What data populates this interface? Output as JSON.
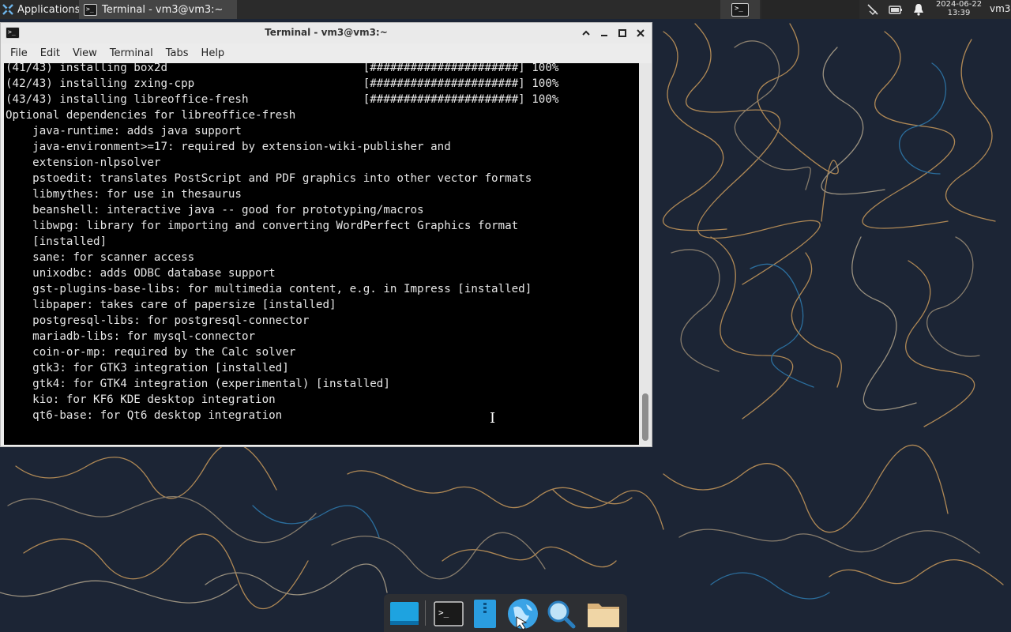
{
  "top_panel": {
    "applications_label": "Applications",
    "task_label": "Terminal - vm3@vm3:~",
    "clock_date": "2024-06-22",
    "clock_time": "13:39",
    "user": "vm3",
    "icons": [
      "applications-menu-icon",
      "terminal-icon",
      "workspace-icon",
      "network-disconnected-icon",
      "battery-icon",
      "notification-bell-icon"
    ]
  },
  "window": {
    "title": "Terminal - vm3@vm3:~",
    "menu": [
      "File",
      "Edit",
      "View",
      "Terminal",
      "Tabs",
      "Help"
    ],
    "terminal_lines": [
      "(41/43) installing box2d                             [######################] 100%",
      "(42/43) installing zxing-cpp                         [######################] 100%",
      "(43/43) installing libreoffice-fresh                 [######################] 100%",
      "Optional dependencies for libreoffice-fresh",
      "    java-runtime: adds java support",
      "    java-environment>=17: required by extension-wiki-publisher and",
      "    extension-nlpsolver",
      "    pstoedit: translates PostScript and PDF graphics into other vector formats",
      "    libmythes: for use in thesaurus",
      "    beanshell: interactive java -- good for prototyping/macros",
      "    libwpg: library for importing and converting WordPerfect Graphics format",
      "    [installed]",
      "    sane: for scanner access",
      "    unixodbc: adds ODBC database support",
      "    gst-plugins-base-libs: for multimedia content, e.g. in Impress [installed]",
      "    libpaper: takes care of papersize [installed]",
      "    postgresql-libs: for postgresql-connector",
      "    mariadb-libs: for mysql-connector",
      "    coin-or-mp: required by the Calc solver",
      "    gtk3: for GTK3 integration [installed]",
      "    gtk4: for GTK4 integration (experimental) [installed]",
      "    kio: for KF6 KDE desktop integration",
      "    qt6-base: for Qt6 desktop integration"
    ]
  },
  "dock": {
    "items": [
      "show-desktop",
      "terminal",
      "file-manager",
      "web-browser",
      "app-finder",
      "home-folder"
    ]
  },
  "colors": {
    "panel": "#2b2b2b",
    "terminal_bg": "#000000",
    "terminal_fg": "#e6e6e6",
    "desktop_bg": "#1c2535",
    "wallpaper_line_1": "#c99a5b",
    "wallpaper_line_2": "#2e7bb0"
  }
}
